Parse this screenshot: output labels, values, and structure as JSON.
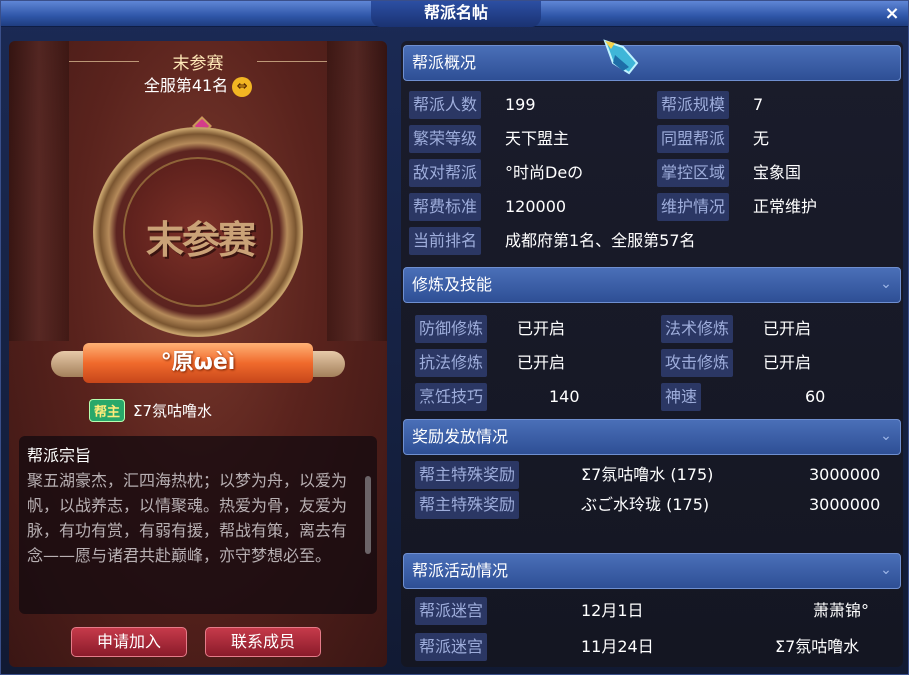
{
  "window": {
    "title": "帮派名帖",
    "close_label": "×"
  },
  "left": {
    "rank_status": "末参赛",
    "rank_line": "全服第41名",
    "swap_icon": "⇔",
    "medal_text": "末参赛",
    "guild_name": "°原ωèì",
    "leader_badge": "帮主",
    "leader_name": "Σ7氛咕噜水",
    "tenet_title": "帮派宗旨",
    "tenet_text": "聚五湖豪杰，汇四海热枕；以梦为舟，以爱为帆，以战养志，以情聚魂。热爱为骨，友爱为脉，有功有赏，有弱有援，帮战有策，离去有念——愿与诸君共赴巅峰，亦守梦想必至。",
    "join_button": "申请加入",
    "contact_button": "联系成员"
  },
  "overview": {
    "header": "帮派概况",
    "rows": [
      {
        "label": "帮派人数",
        "value": "199"
      },
      {
        "label": "帮派规模",
        "value": "7"
      },
      {
        "label": "繁荣等级",
        "value": "天下盟主"
      },
      {
        "label": "同盟帮派",
        "value": "无"
      },
      {
        "label": "敌对帮派",
        "value": "°时尚Deの"
      },
      {
        "label": "掌控区域",
        "value": "宝象国"
      },
      {
        "label": "帮费标准",
        "value": "120000"
      },
      {
        "label": "维护情况",
        "value": "正常维护"
      },
      {
        "label": "当前排名",
        "value": "成都府第1名、全服第57名"
      }
    ]
  },
  "skills": {
    "header": "修炼及技能",
    "rows": [
      {
        "label": "防御修炼",
        "value": "已开启"
      },
      {
        "label": "法术修炼",
        "value": "已开启"
      },
      {
        "label": "抗法修炼",
        "value": "已开启"
      },
      {
        "label": "攻击修炼",
        "value": "已开启"
      },
      {
        "label": "烹饪技巧",
        "value": "140"
      },
      {
        "label": "神速",
        "value": "60"
      }
    ]
  },
  "rewards": {
    "header": "奖励发放情况",
    "rows": [
      {
        "label": "帮主特殊奖励",
        "name": "Σ7氛咕噜水 (175)",
        "amount": "3000000"
      },
      {
        "label": "帮主特殊奖励",
        "name": "ぶご水玲珑 (175)",
        "amount": "3000000"
      }
    ]
  },
  "activities": {
    "header": "帮派活动情况",
    "rows": [
      {
        "label": "帮派迷宫",
        "date": "12月1日",
        "player": "萧萧锦°"
      },
      {
        "label": "帮派迷宫",
        "date": "11月24日",
        "player": "Σ7氛咕噜水"
      }
    ]
  },
  "icons": {
    "close": "close-icon",
    "swap": "swap-icon",
    "chevron": "chevron-down-icon",
    "gem": "gem-cursor-icon"
  },
  "colors": {
    "header_blue": "#2e4f95",
    "label_chip": "#2b3764",
    "button_red": "#c63a4a",
    "banner_orange": "#f06a2c"
  }
}
